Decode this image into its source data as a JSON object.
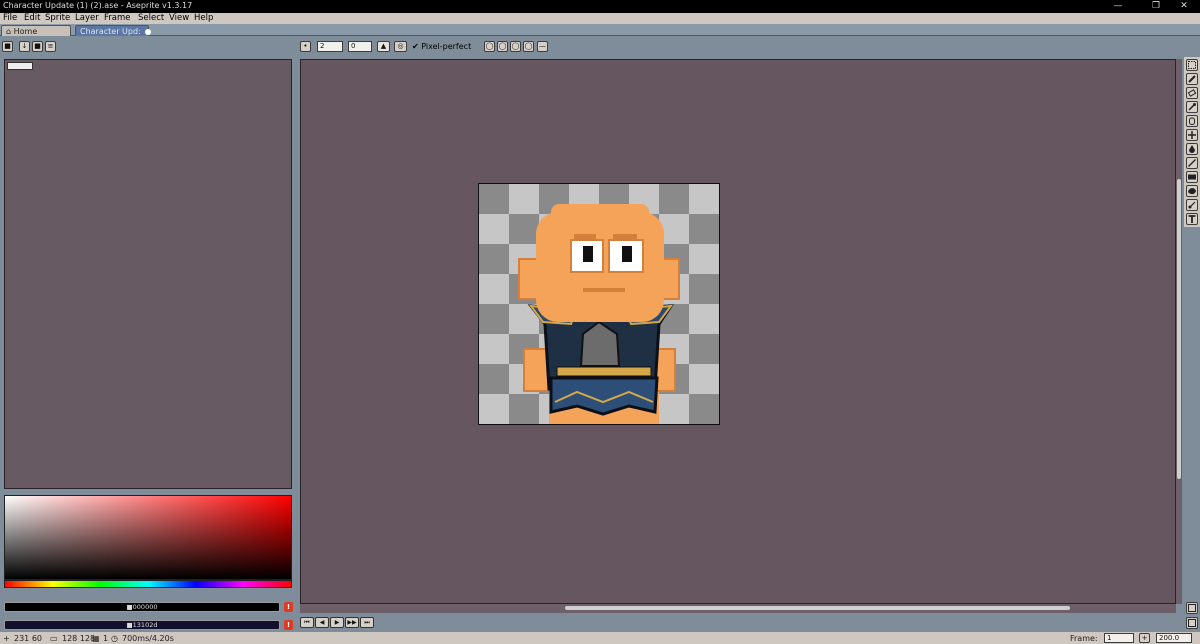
{
  "window": {
    "title": "Character Update (1) (2).ase - Aseprite v1.3.17",
    "minimize_glyph": "—",
    "maximize_glyph": "❐",
    "close_glyph": "✕"
  },
  "menu": {
    "items": [
      "File",
      "Edit",
      "Sprite",
      "Layer",
      "Frame",
      "Select",
      "View",
      "Help"
    ]
  },
  "tabs": [
    {
      "label": "Home",
      "icon": "home-icon"
    },
    {
      "label": "Character Upd:",
      "icon": "modified-dot-icon"
    }
  ],
  "context_bar": {
    "brush_size": "2",
    "brush_angle": "0",
    "pixel_perfect_label": "Pixel-perfect",
    "pixel_perfect_checked": true,
    "symmetry_icons": [
      "symmetry-none-icon",
      "symmetry-h-icon",
      "symmetry-v-icon",
      "symmetry-both-icon"
    ]
  },
  "colors": {
    "fg_hex": "#000000",
    "fg_label": "■000000",
    "bg_hex": "#13102d",
    "bg_label": "■13102d",
    "warning_glyph": "!"
  },
  "playback": {
    "buttons": [
      "⏮",
      "◀",
      "▶",
      "▶▶",
      "⏭"
    ]
  },
  "status": {
    "cursor_pos": "231 60",
    "sprite_size": "128 128",
    "frame_index": "1",
    "frame_duration": "700ms/4.20s",
    "frame_label": "Frame:",
    "frame_value": "1",
    "zoom_value": "200.0"
  },
  "tools": [
    "rect-marquee-icon",
    "pencil-icon",
    "eraser-icon",
    "eyedropper-icon",
    "hand-icon",
    "move-icon",
    "fill-bucket-icon",
    "line-icon",
    "rectangle-icon",
    "contour-icon",
    "blur-icon",
    "text-icon"
  ]
}
